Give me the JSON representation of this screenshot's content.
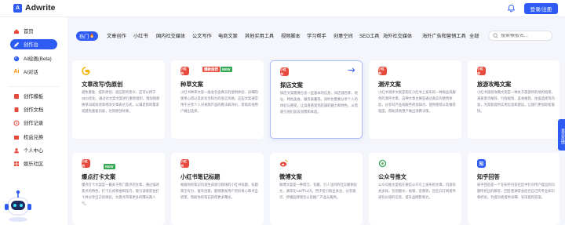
{
  "app": {
    "logo_mark": "A",
    "title": "Adwrite",
    "login_button": "登录/注册"
  },
  "sidebar": {
    "items": [
      {
        "label": "首页",
        "icon": "home-icon"
      },
      {
        "label": "创作台",
        "icon": "pen-icon"
      },
      {
        "label": "AI绘画(Beta)",
        "icon": "palette-icon"
      },
      {
        "label": "AI对话",
        "icon": "chat-icon"
      },
      {
        "label": "创作模板",
        "icon": "template-icon"
      },
      {
        "label": "创作文档",
        "icon": "document-icon"
      },
      {
        "label": "创作记录",
        "icon": "history-icon"
      },
      {
        "label": "权益兑换",
        "icon": "gift-icon"
      },
      {
        "label": "个人中心",
        "icon": "user-icon"
      },
      {
        "label": "娱乐社区",
        "icon": "community-icon"
      }
    ]
  },
  "tabs": [
    "热门",
    "文章创作",
    "小红书",
    "国内社交媒体",
    "公文写作",
    "电商文案",
    "其他实用工具",
    "视频脚本",
    "学习帮手",
    "创意空间",
    "SEO工具",
    "海外社交媒体",
    "海外广告和营销工具",
    "全部"
  ],
  "search": {
    "placeholder": "搜索模板名..."
  },
  "cards": [
    {
      "title": "文章改写/伪原创",
      "icon_color": "#f2b400",
      "icon_text": "✦",
      "desc": "避免重复、提升原创、适应新的受众、还可以用于SEO优化、通过对文案文案进行重新组织、增加和替换单词或短语等修改文章表达方式，以满足新的需求或避免重复内容，达到原创效果。",
      "badges": [],
      "arrow": false
    },
    {
      "title": "种草文案",
      "icon_color": "#e64a3c",
      "icon_text": "小",
      "desc": "小红书种草文案一般会包含真实的使用体验、详细的使用心得以及具有亲和力的语言风格。这些文案通常用于分享个人对某款产品的看法和评价，帮助其他用户做出选择。",
      "badges": [
        "爆款推荐",
        "NEW"
      ],
      "arrow": false
    },
    {
      "title": "探店文案",
      "icon_color": "#e64a3c",
      "icon_text": "小",
      "desc": "探店文案需要包含一些基本的信息，如店铺名称、地址、特色美食、服务质量等。同时也需要分享个人的体验与感受，让读者感受到店铺的魅力和特色，从而吸引他们前去消费和体验。",
      "badges": [],
      "arrow": true
    },
    {
      "title": "测评文案",
      "icon_color": "#e64a3c",
      "icon_text": "小",
      "desc": "小红书测评文案是指在小红书上发布的一种商品或服务的测评文章。这种文章主要是通过真实的使用体验，分享对产品或服务的优缺点、使用感受以及推荐程度，帮助其他用户做出消费决策。",
      "badges": [],
      "arrow": false
    },
    {
      "title": "旅游攻略文案",
      "icon_color": "#e64a3c",
      "icon_text": "小",
      "desc": "小红书旅游攻略文案是一种关于旅游目的地的指南，涵盖景点推荐、行程规划、美食推荐、住宿选择等内容，为游客提供实用信息和建议，让旅行更加轻松愉快。",
      "badges": [],
      "arrow": false
    },
    {
      "title": "爆点打卡文案",
      "icon_color": "#e64a3c",
      "icon_text": "小",
      "desc": "爆点打卡文案是一篇关于热门景点的文章，通过描述景点的特色、打卡方式和拍照技巧，吸引读者前往打卡并分享自己的体验，为景点带来更多的曝光和人气。",
      "badges": [
        "NEW"
      ],
      "arrow": false
    },
    {
      "title": "小红书笔记标题",
      "icon_color": "#e64a3c",
      "icon_text": "小",
      "desc": "根据你的笔记内容生成吸引眼球的小红书标题，标题简洁有力、富有创意，能够激发用户的好奇心和点击欲望，帮助你的笔记获得更多曝光。",
      "badges": [],
      "arrow": false
    },
    {
      "title": "微博文案",
      "icon_color": "#f28c00",
      "icon_text": "微",
      "desc": "微博文案是一种简洁、有趣、引人注目的社交媒体短文，通常在140字以内，用于吸引粉丝关注、分享观点、传播品牌理念以及推广产品与服务。",
      "badges": [],
      "arrow": false
    },
    {
      "title": "公众号推文",
      "icon_color": "#34a853",
      "icon_text": "◎",
      "desc": "公众号推文是指在微信公众号上发布的文章，内容形式多样，包括图文、视频、音频等，旨在向订阅者传递有价值的信息，提升品牌影响力。",
      "badges": [],
      "arrow": false
    },
    {
      "title": "知乎回答",
      "icon_color": "#2f5bf5",
      "icon_text": "知",
      "desc": "知乎回答是一个在知乎问答社区中针对用户提出的问题所给出的解答，回答者通常会结合自己的专业知识和经验，为提问者提供详细、有深度的答案。",
      "badges": [],
      "arrow": false
    }
  ],
  "float_button": {
    "label": "意见反馈"
  }
}
